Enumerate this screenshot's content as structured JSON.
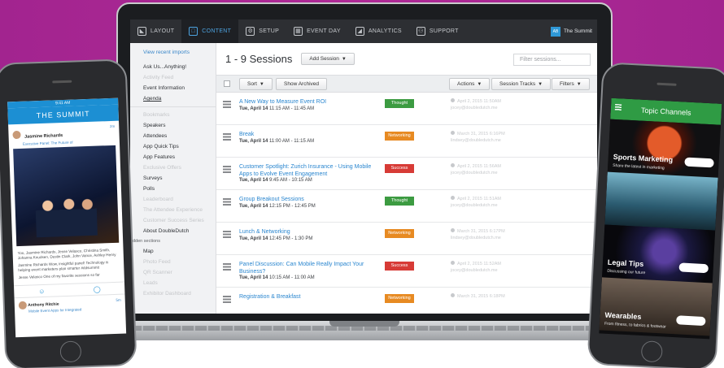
{
  "app": {
    "nav": [
      {
        "label": "LAYOUT",
        "icon": "layout-icon",
        "glyph": "◣"
      },
      {
        "label": "CONTENT",
        "icon": "content-icon",
        "glyph": "□"
      },
      {
        "label": "SETUP",
        "icon": "gear-icon",
        "glyph": "⚙"
      },
      {
        "label": "EVENT DAY",
        "icon": "calendar-icon",
        "glyph": "▦"
      },
      {
        "label": "ANALYTICS",
        "icon": "analytics-icon",
        "glyph": "◢"
      },
      {
        "label": "SUPPORT",
        "icon": "support-icon",
        "glyph": "⚇"
      }
    ],
    "active_nav": 1,
    "brand": {
      "logo_text": "AB",
      "name": "The Summit"
    },
    "sidebar": {
      "link": "View recent imports",
      "items": [
        {
          "label": "Ask Us...Anything!",
          "muted": false
        },
        {
          "label": "Activity Feed",
          "muted": true
        },
        {
          "label": "Event Information",
          "muted": false
        },
        {
          "label": "Agenda",
          "muted": false,
          "underline": true
        },
        {
          "sep": true
        },
        {
          "label": "Bookmarks",
          "muted": true
        },
        {
          "label": "Speakers",
          "muted": false
        },
        {
          "label": "Attendees",
          "muted": false
        },
        {
          "label": "App Quick Tips",
          "muted": false
        },
        {
          "label": "App Features",
          "muted": false
        },
        {
          "label": "Exclusive Offers",
          "muted": true
        },
        {
          "label": "Surveys",
          "muted": false
        },
        {
          "label": "Polls",
          "muted": false
        },
        {
          "label": "Leaderboard",
          "muted": true
        },
        {
          "label": "The Attendee Experience",
          "muted": true
        },
        {
          "label": "Customer Success Series",
          "muted": true
        },
        {
          "label": "About DoubleDutch",
          "muted": false
        },
        {
          "section": "dden sections"
        },
        {
          "label": "Map",
          "muted": false
        },
        {
          "label": "Photo Feed",
          "muted": true
        },
        {
          "label": "QR Scanner",
          "muted": true
        },
        {
          "label": "Leads",
          "muted": true
        },
        {
          "label": "Exhibitor Dashboard",
          "muted": true
        }
      ]
    },
    "main": {
      "title": "1 - 9 Sessions",
      "add_label": "Add Session",
      "filter_placeholder": "Filter sessions...",
      "toolbar": {
        "sort": "Sort",
        "archived": "Show Archived",
        "actions": "Actions",
        "tracks": "Session Tracks",
        "filters": "Filters"
      },
      "sessions": [
        {
          "title": "A New Way to Measure Event ROI",
          "day": "Tue, April 14",
          "time": "11:15 AM - 11:45 AM",
          "tag": "Thought",
          "tag_type": "thought",
          "updated": "April 2, 2015 11:50AM",
          "by": "jocey@doubledutch.me"
        },
        {
          "title": "Break",
          "day": "Tue, April 14",
          "time": "11:00 AM - 11:15 AM",
          "tag": "Networking",
          "tag_type": "networking",
          "updated": "March 31, 2015 6:16PM",
          "by": "lindsey@doubledutch.me"
        },
        {
          "title": "Customer Spotlight: Zurich Insurance - Using Mobile Apps to Evolve Event Engagement",
          "day": "Tue, April 14",
          "time": "9:45 AM - 10:15 AM",
          "tag": "Success",
          "tag_type": "success",
          "updated": "April 2, 2015 11:56AM",
          "by": "jocey@doubledutch.me"
        },
        {
          "title": "Group Breakout Sessions",
          "day": "Tue, April 14",
          "time": "12:15 PM - 12:45 PM",
          "tag": "Thought",
          "tag_type": "thought",
          "updated": "April 2, 2015 11:51AM",
          "by": "jocey@doubledutch.me"
        },
        {
          "title": "Lunch & Networking",
          "day": "Tue, April 14",
          "time": "12:45 PM - 1:30 PM",
          "tag": "Networking",
          "tag_type": "networking",
          "updated": "March 31, 2015 6:17PM",
          "by": "lindsey@doubledutch.me"
        },
        {
          "title": "Panel Discussion: Can Mobile Really Impact Your Business?",
          "day": "Tue, April 14",
          "time": "10:15 AM - 11:00 AM",
          "tag": "Success",
          "tag_type": "success",
          "updated": "April 2, 2015 11:52AM",
          "by": "jocey@doubledutch.me"
        },
        {
          "title": "Registration & Breakfast",
          "day": "",
          "time": "",
          "tag": "Networking",
          "tag_type": "networking",
          "updated": "March 31, 2015 6:18PM",
          "by": ""
        }
      ]
    }
  },
  "phone_left": {
    "status_time": "9:41 AM",
    "header": "THE SUMMIT",
    "post": {
      "name": "Jasmine Richards",
      "sub": "Executive Panel: The Future of",
      "time": "2m",
      "text_1": "You, Jasmine Richards, Jesse Velasco, Christina Smith, Johanna Knudsen, Dustin Clark, John Vance, Ashley Henry",
      "text_2": "Jasmine Richards Wow, insightful panel! Technology is helping event marketers plan smarter #ddsummit",
      "text_3": "Jesse Velasco One of my favorite sessions so far"
    },
    "footer_name": "Anthony Ritchie",
    "footer_sub": "Mobile Event Apps for Integrated",
    "footer_time": "5m"
  },
  "phone_right": {
    "header": "Topic Channels",
    "tiles": [
      {
        "title": "Sports Marketing",
        "sub": "Share the latest in marketing"
      },
      {
        "title": "",
        "sub": ""
      },
      {
        "title": "Legal Tips",
        "sub": "Discussing our future"
      },
      {
        "title": "Wearables",
        "sub": "From fitness, to fabrics & footwear"
      }
    ]
  },
  "colors": {
    "brand_blue": "#2a86cf",
    "thought": "#3c9b41",
    "networking": "#e78a22",
    "success": "#d73b36",
    "background_band": "#a2248f"
  }
}
